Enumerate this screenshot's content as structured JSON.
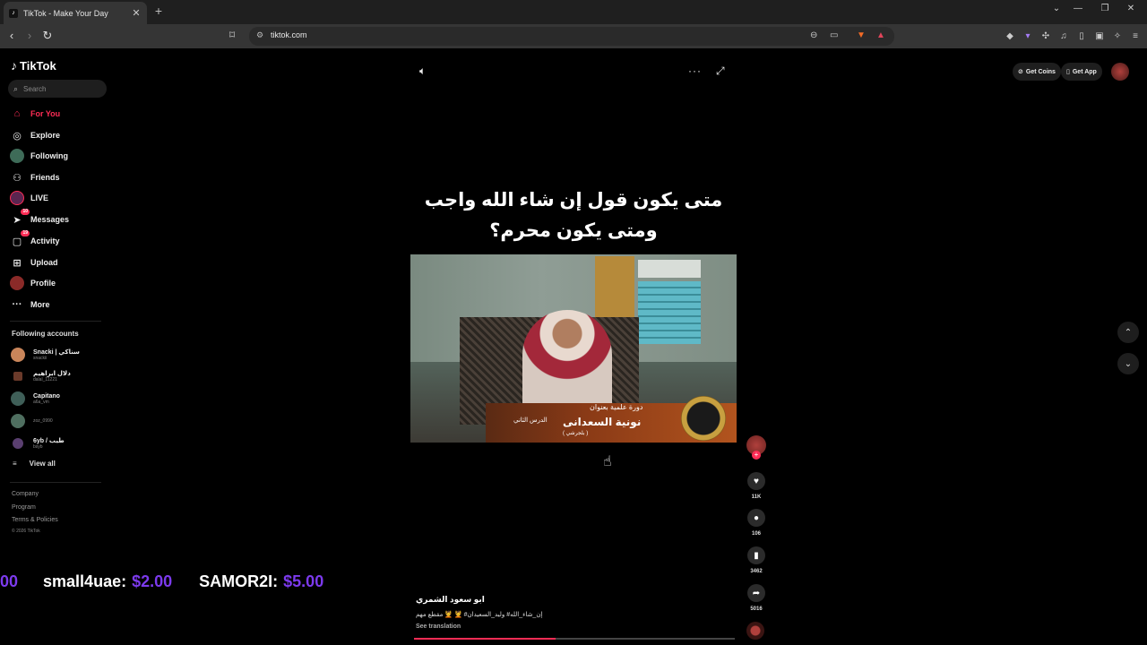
{
  "browser": {
    "tab_title": "TikTok - Make Your Day",
    "url": "tiktok.com"
  },
  "brand": {
    "name": "TikTok"
  },
  "search": {
    "placeholder": "Search"
  },
  "nav": [
    {
      "label": "For You",
      "icon": "home-icon"
    },
    {
      "label": "Explore",
      "icon": "compass-icon"
    },
    {
      "label": "Following",
      "icon": "avatar"
    },
    {
      "label": "Friends",
      "icon": "friends-icon"
    },
    {
      "label": "LIVE",
      "icon": "live-avatar"
    },
    {
      "label": "Messages",
      "icon": "messages-icon",
      "badge": "10"
    },
    {
      "label": "Activity",
      "icon": "activity-icon",
      "badge": "19"
    },
    {
      "label": "Upload",
      "icon": "upload-icon"
    },
    {
      "label": "Profile",
      "icon": "profile-avatar"
    },
    {
      "label": "More",
      "icon": "more-icon"
    }
  ],
  "following": {
    "title": "Following accounts",
    "accounts": [
      {
        "name": "Snacki | سناكي",
        "handle": "snackii"
      },
      {
        "name": "دلال ابراهيم",
        "handle": "dalal_11221"
      },
      {
        "name": "Capitano",
        "handle": "a6a_vm"
      },
      {
        "name": "",
        "handle": "zoz_0990"
      },
      {
        "name": "6yb / طيب",
        "handle": "bsyb"
      }
    ],
    "view_all": "View all"
  },
  "footer": {
    "links": [
      "Company",
      "Program",
      "Terms & Policies"
    ],
    "copyright": "© 2026 TikTok"
  },
  "ticker": [
    {
      "name": "",
      "amount": "00"
    },
    {
      "name": "small4uae:",
      "amount": "$2.00"
    },
    {
      "name": "SAMOR2I:",
      "amount": "$5.00"
    }
  ],
  "video": {
    "overlay_title_line1": "متى يكون قول إن شاء الله واجب",
    "overlay_title_line2": "ومتى يكون محرم؟",
    "banner_line1": "دورة علمية بعنوان",
    "banner_line2": "نونية السعدانى",
    "banner_line3": "الدرس الثاني",
    "banner_line4": "( بلجرشي )",
    "author": "ابو سعود الشمري",
    "caption": "إن_شاء_الله# وليد_السعيدان# 💆 💆 مقطع مهم",
    "see_translation": "See translation",
    "progress": 0.44
  },
  "actions": {
    "likes": "11K",
    "comments": "106",
    "saves": "3462",
    "shares": "5016"
  },
  "top_right": {
    "get_coins": "Get Coins",
    "get_app": "Get App"
  },
  "colors": {
    "accent": "#fe2c55",
    "donation_amount": "#7c3aed"
  }
}
